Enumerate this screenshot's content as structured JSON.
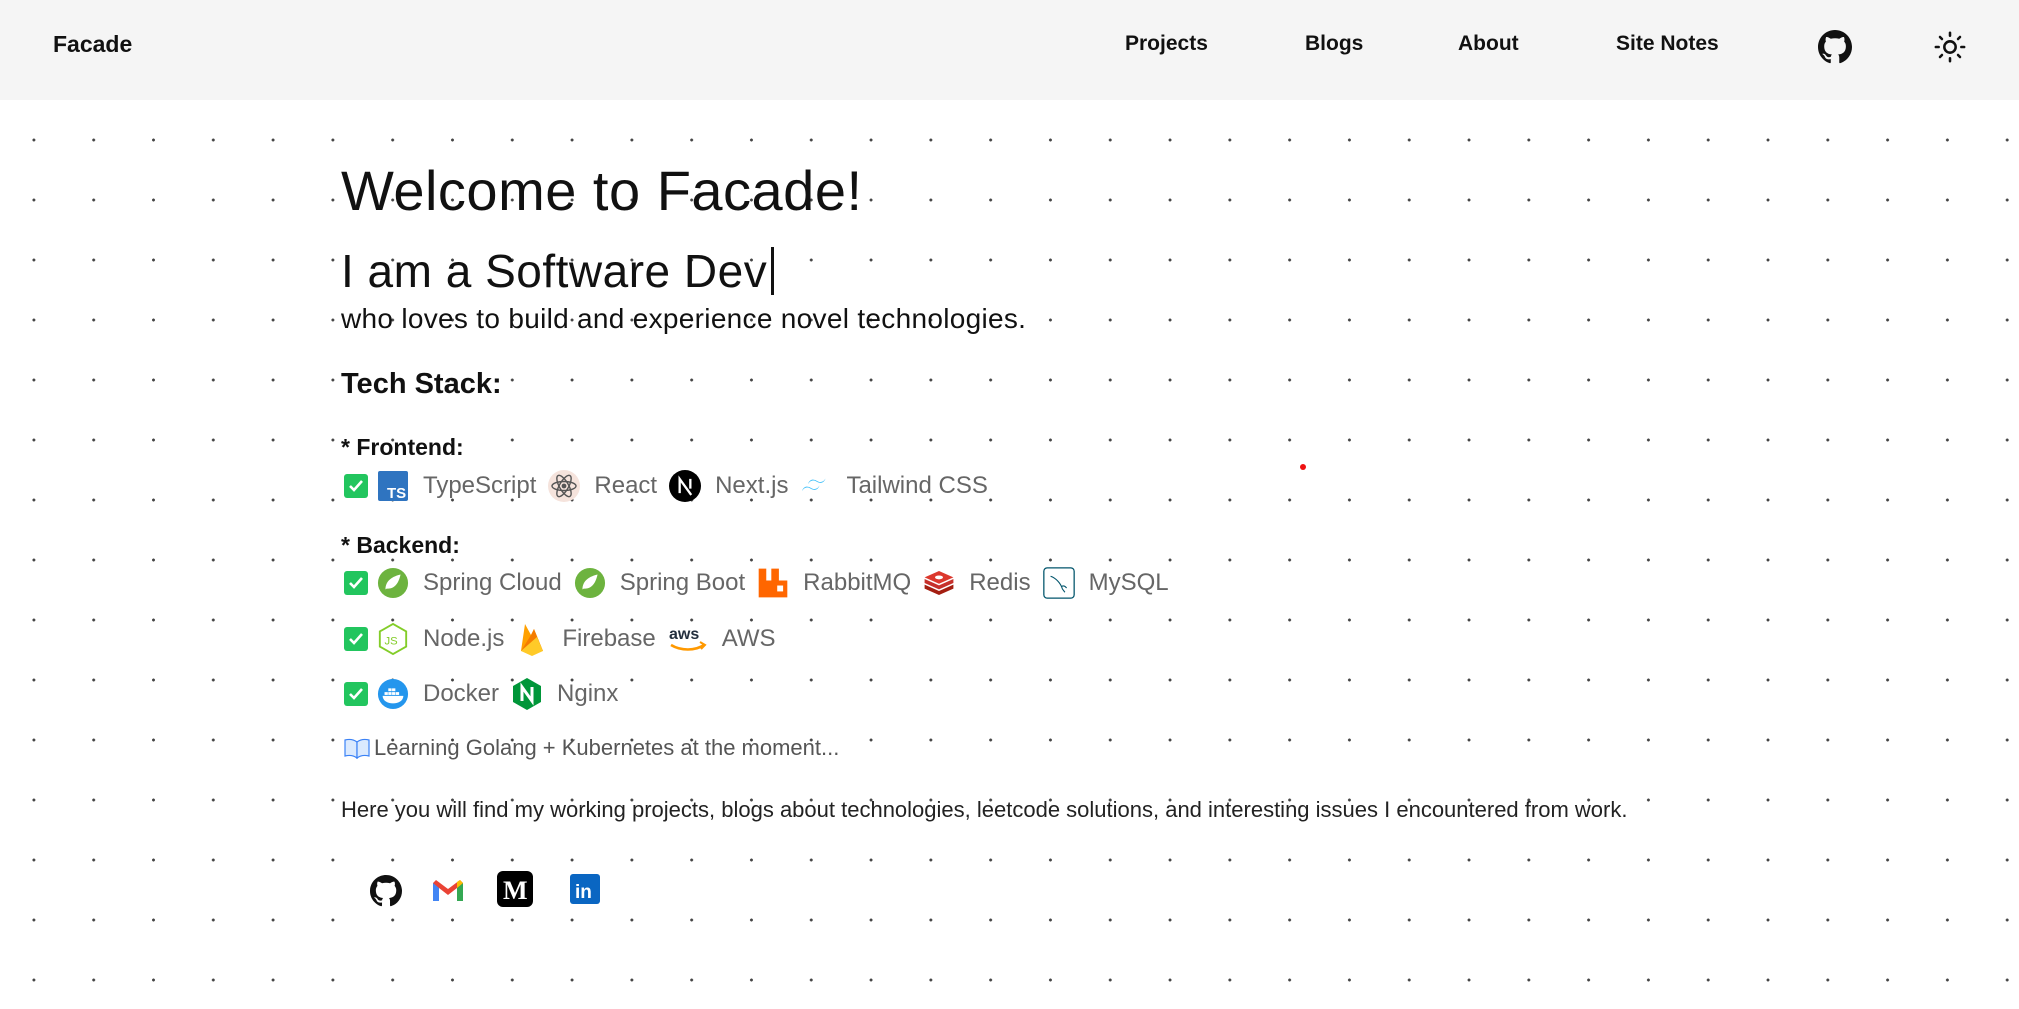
{
  "header": {
    "brand": "Facade",
    "nav": [
      "Projects",
      "Blogs",
      "About",
      "Site Notes"
    ],
    "icons": [
      "github-icon",
      "sun-icon"
    ]
  },
  "hero": {
    "title": "Welcome to Facade!",
    "typed_text": "I am a Software Dev",
    "subtitle": "who loves to build and experience novel technologies."
  },
  "tech_stack": {
    "heading": "Tech Stack:",
    "frontend_heading": "* Frontend:",
    "frontend": [
      {
        "name": "TypeScript",
        "icon": "typescript-icon"
      },
      {
        "name": "React",
        "icon": "react-icon"
      },
      {
        "name": "Next.js",
        "icon": "nextjs-icon"
      },
      {
        "name": "Tailwind CSS",
        "icon": "tailwind-icon"
      }
    ],
    "backend_heading": "* Backend:",
    "backend_rows": [
      [
        {
          "name": "Spring Cloud",
          "icon": "spring-icon"
        },
        {
          "name": "Spring Boot",
          "icon": "spring-boot-icon"
        },
        {
          "name": "RabbitMQ",
          "icon": "rabbitmq-icon"
        },
        {
          "name": "Redis",
          "icon": "redis-icon"
        },
        {
          "name": "MySQL",
          "icon": "mysql-icon"
        }
      ],
      [
        {
          "name": "Node.js",
          "icon": "nodejs-icon"
        },
        {
          "name": "Firebase",
          "icon": "firebase-icon"
        },
        {
          "name": "AWS",
          "icon": "aws-icon"
        }
      ],
      [
        {
          "name": "Docker",
          "icon": "docker-icon"
        },
        {
          "name": "Nginx",
          "icon": "nginx-icon"
        }
      ]
    ],
    "learning": "Learning Golang + Kubernetes at the moment..."
  },
  "intro": "Here you will find my working projects, blogs about technologies, leetcode solutions, and interesting issues I encountered from work.",
  "social": [
    "github-icon",
    "gmail-icon",
    "medium-icon",
    "linkedin-icon"
  ],
  "colors": {
    "accent_green": "#22c55e",
    "topbar_bg": "#f5f5f5"
  }
}
